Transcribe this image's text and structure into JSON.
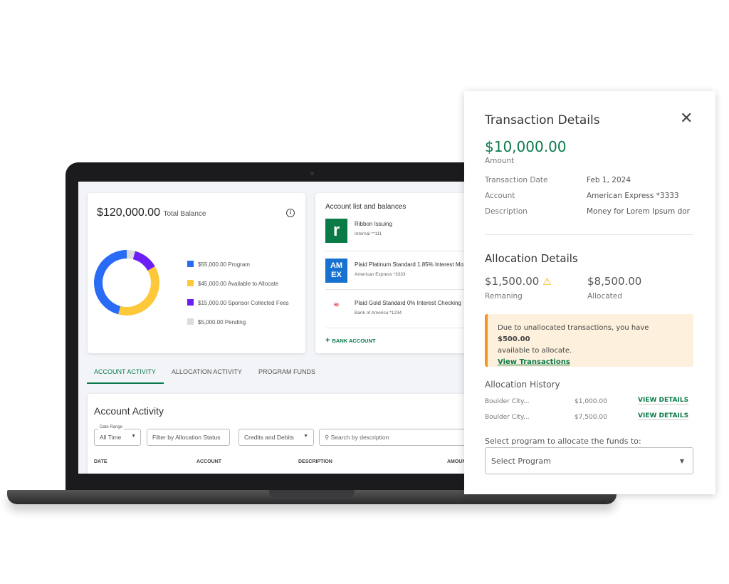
{
  "balance": {
    "total": "$120,000.00",
    "label": "Total Balance",
    "info_icon": "info-circle-icon",
    "legend": [
      {
        "text": "$55,000.00 Program",
        "value": 55000,
        "color": "#2a6bf6"
      },
      {
        "text": "$45,000.00 Available to Allocate",
        "value": 45000,
        "color": "#fdc93b"
      },
      {
        "text": "$15,000.00 Sponsor Collected Fees",
        "value": 15000,
        "color": "#6c1ff5"
      },
      {
        "text": "$5,000.00 Pending",
        "value": 5000,
        "color": "#dcdcdc"
      }
    ]
  },
  "accounts": {
    "title": "Account list and balances",
    "items": [
      {
        "name": "Ribbon Issuing",
        "sub": "Internal **111",
        "logo": "ribbon-logo"
      },
      {
        "name": "Plaid Platinum Standard 1.85% Interest Mo",
        "sub": "American Express *3333",
        "logo": "amex-logo"
      },
      {
        "name": "Plaid Gold Standard 0% Interest Checking",
        "sub": "Bank of America *1234",
        "logo": "bank-of-america-logo"
      }
    ],
    "add_label": "BANK ACCOUNT"
  },
  "tabs": [
    "ACCOUNT ACTIVITY",
    "ALLOCATION ACTIVITY",
    "PROGRAM FUNDS"
  ],
  "activity": {
    "title": "Account Activity",
    "date_range_label": "Date Range",
    "date_range": "All Time",
    "allocation_filter": "Filter by Allocation Status",
    "credit_filter": "Credits and Debits",
    "search_placeholder": "Search by description",
    "columns": [
      "DATE",
      "ACCOUNT",
      "DESCRIPTION",
      "AMOUN"
    ]
  },
  "details": {
    "title": "Transaction Details",
    "amount": "$10,000.00",
    "amount_label": "Amount",
    "rows": [
      {
        "label": "Transaction Date",
        "value": "Feb 1, 2024"
      },
      {
        "label": "Account",
        "value": "American Express *3333"
      },
      {
        "label": "Description",
        "value": "Money for Lorem Ipsum dor"
      }
    ],
    "allocation_title": "Allocation Details",
    "remaining": "$1,500.00",
    "remaining_label": "Remaning",
    "allocated": "$8,500.00",
    "allocated_label": "Allocated",
    "alert_text": "Due to unallocated transactions, you have ",
    "alert_amount": "$500.00",
    "alert_text2": "available to allocate.",
    "alert_link": "View Transactions",
    "history_title": "Allocation History",
    "history": [
      {
        "name": "Boulder City...",
        "amount": "$1,000.00",
        "action": "VIEW DETAILS"
      },
      {
        "name": "Boulder City...",
        "amount": "$7,500.00",
        "action": "VIEW DETAILS"
      }
    ],
    "select_label": "Select program to allocate the funds to:",
    "select_placeholder": "Select Program"
  },
  "colors": {
    "accent": "#0b7a4b",
    "warning": "#f7931e",
    "alert_bg": "#fdf1dd"
  }
}
